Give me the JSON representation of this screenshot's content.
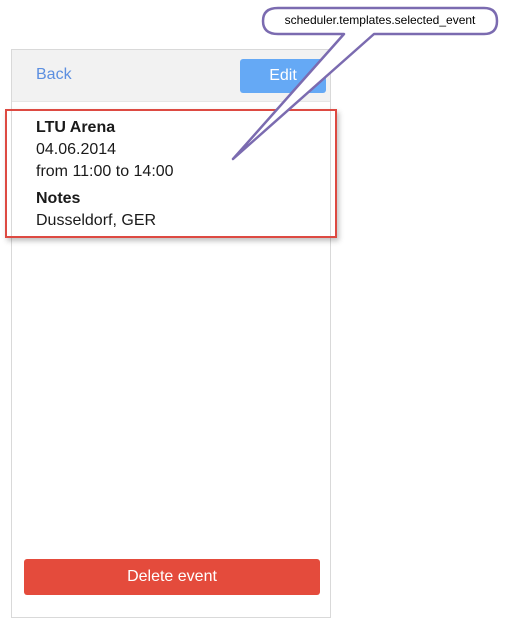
{
  "toolbar": {
    "back_label": "Back",
    "edit_label": "Edit"
  },
  "event": {
    "title": "LTU Arena",
    "date": "04.06.2014",
    "time_range": "from 11:00 to 14:00",
    "notes_heading": "Notes",
    "notes": "Dusseldorf, GER"
  },
  "actions": {
    "delete_label": "Delete event"
  },
  "callout": {
    "label": "scheduler.templates.selected_event"
  },
  "colors": {
    "link": "#5c8fe0",
    "edit_button": "#65a9f5",
    "delete_button": "#e44b3c",
    "highlight_border": "#dd4a42",
    "callout_stroke": "#7b6bb0"
  }
}
